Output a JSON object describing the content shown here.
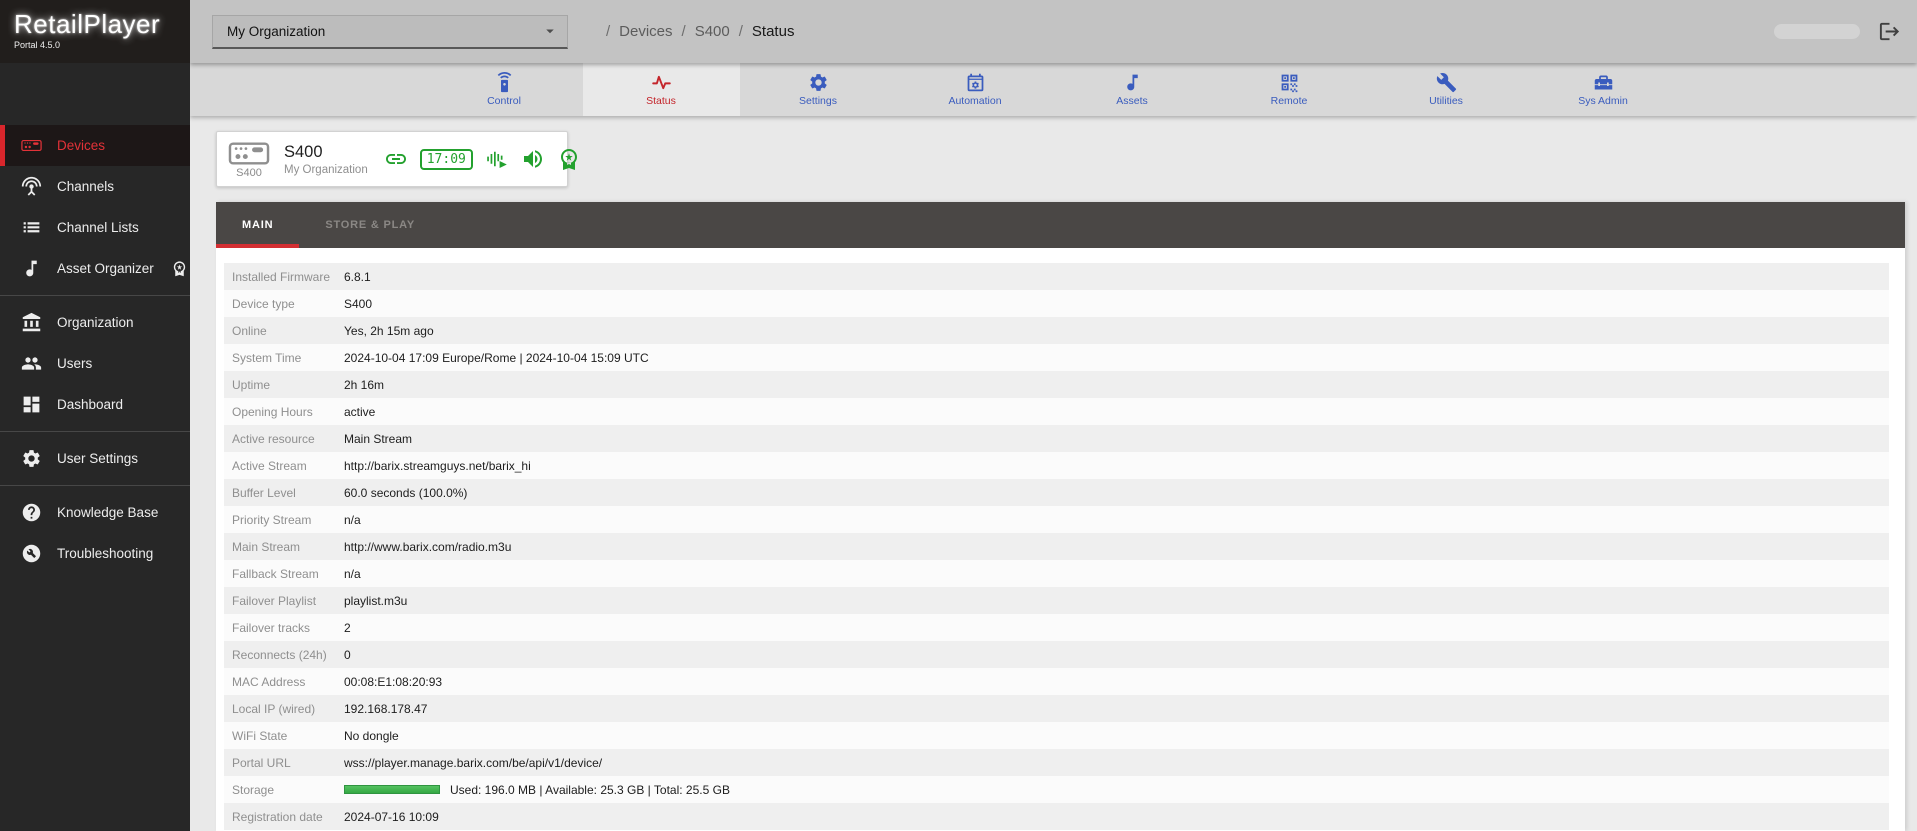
{
  "brand": {
    "name": "RetailPlayer",
    "subtitle": "Portal 4.5.0"
  },
  "header": {
    "org_selector": {
      "value": "My Organization",
      "caret_icon": "caret-down-icon"
    },
    "breadcrumb_separator": "/",
    "breadcrumb": [
      "Devices",
      "S400",
      "Status"
    ],
    "logout_icon": "logout-icon"
  },
  "sidebar": {
    "groups": [
      {
        "items": [
          {
            "name": "sidebar-item-devices",
            "label": "Devices",
            "icon": "player-device-icon",
            "active": true
          },
          {
            "name": "sidebar-item-channels",
            "label": "Channels",
            "icon": "antenna-icon"
          },
          {
            "name": "sidebar-item-channel-lists",
            "label": "Channel Lists",
            "icon": "list-icon"
          },
          {
            "name": "sidebar-item-asset-organizer",
            "label": "Asset Organizer",
            "icon": "music-note-icon",
            "badge_icon": "award-icon"
          }
        ]
      },
      {
        "items": [
          {
            "name": "sidebar-item-organization",
            "label": "Organization",
            "icon": "bank-icon"
          },
          {
            "name": "sidebar-item-users",
            "label": "Users",
            "icon": "users-icon"
          },
          {
            "name": "sidebar-item-dashboard",
            "label": "Dashboard",
            "icon": "dashboard-icon"
          }
        ]
      },
      {
        "items": [
          {
            "name": "sidebar-item-user-settings",
            "label": "User Settings",
            "icon": "gear-icon"
          }
        ]
      },
      {
        "items": [
          {
            "name": "sidebar-item-knowledge-base",
            "label": "Knowledge Base",
            "icon": "help-circle-icon"
          },
          {
            "name": "sidebar-item-troubleshooting",
            "label": "Troubleshooting",
            "icon": "wrench-circle-icon"
          }
        ]
      }
    ]
  },
  "tabs": [
    {
      "name": "tab-control",
      "label": "Control",
      "icon": "remote-control-icon"
    },
    {
      "name": "tab-status",
      "label": "Status",
      "icon": "pulse-icon",
      "active": true
    },
    {
      "name": "tab-settings",
      "label": "Settings",
      "icon": "gear-icon"
    },
    {
      "name": "tab-automation",
      "label": "Automation",
      "icon": "calendar-gear-icon"
    },
    {
      "name": "tab-assets",
      "label": "Assets",
      "icon": "music-note-icon"
    },
    {
      "name": "tab-remote",
      "label": "Remote",
      "icon": "qr-code-icon"
    },
    {
      "name": "tab-utilities",
      "label": "Utilities",
      "icon": "wrench-icon"
    },
    {
      "name": "tab-sysadmin",
      "label": "Sys Admin",
      "icon": "toolbox-icon"
    }
  ],
  "device_card": {
    "model_label": "S400",
    "title": "S400",
    "org": "My Organization",
    "device_icon": "player-device-icon",
    "status": [
      {
        "name": "link-icon",
        "icon": "link-icon"
      },
      {
        "name": "device-clock",
        "clock": "17:09"
      },
      {
        "name": "audio-wave-play-icon",
        "icon": "audio-wave-play-icon"
      },
      {
        "name": "volume-up-icon",
        "icon": "volume-up-icon"
      },
      {
        "name": "award-icon",
        "icon": "award-icon"
      }
    ]
  },
  "content_tabs": [
    {
      "name": "content-tab-main",
      "label": "MAIN",
      "active": true
    },
    {
      "name": "content-tab-store-play",
      "label": "STORE & PLAY"
    }
  ],
  "details": {
    "rows": [
      {
        "label": "Installed Firmware",
        "value": "6.8.1"
      },
      {
        "label": "Device type",
        "value": "S400"
      },
      {
        "label": "Online",
        "value": "Yes, 2h 15m ago"
      },
      {
        "label": "System Time",
        "value": "2024-10-04 17:09 Europe/Rome | 2024-10-04 15:09 UTC"
      },
      {
        "label": "Uptime",
        "value": "2h 16m"
      },
      {
        "label": "Opening Hours",
        "value": "active"
      },
      {
        "label": "Active resource",
        "value": "Main Stream"
      },
      {
        "label": "Active Stream",
        "value": "http://barix.streamguys.net/barix_hi"
      },
      {
        "label": "Buffer Level",
        "value": "60.0 seconds (100.0%)"
      },
      {
        "label": "Priority Stream",
        "value": "n/a"
      },
      {
        "label": "Main Stream",
        "value": "http://www.barix.com/radio.m3u"
      },
      {
        "label": "Fallback Stream",
        "value": "n/a"
      },
      {
        "label": "Failover Playlist",
        "value": "playlist.m3u"
      },
      {
        "label": "Failover tracks",
        "value": "2"
      },
      {
        "label": "Reconnects (24h)",
        "value": "0"
      },
      {
        "label": "MAC Address",
        "value": "00:08:E1:08:20:93"
      },
      {
        "label": "Local IP (wired)",
        "value": "192.168.178.47"
      },
      {
        "label": "WiFi State",
        "value": "No dongle"
      },
      {
        "label": "Portal URL",
        "value": "wss://player.manage.barix.com/be/api/v1/device/"
      },
      {
        "label": "Storage",
        "value": "Used: 196.0 MB | Available: 25.3 GB | Total: 25.5 GB",
        "bar": true
      },
      {
        "label": "Registration date",
        "value": "2024-07-16 10:09"
      }
    ]
  },
  "colors": {
    "accent_red": "#d9262c",
    "tab_blue": "#3a5cbe",
    "status_green": "#23a12e",
    "sidebar_bg": "#272727",
    "header_bg": "#c3c3c3",
    "darkbar_bg": "#4a4745"
  }
}
